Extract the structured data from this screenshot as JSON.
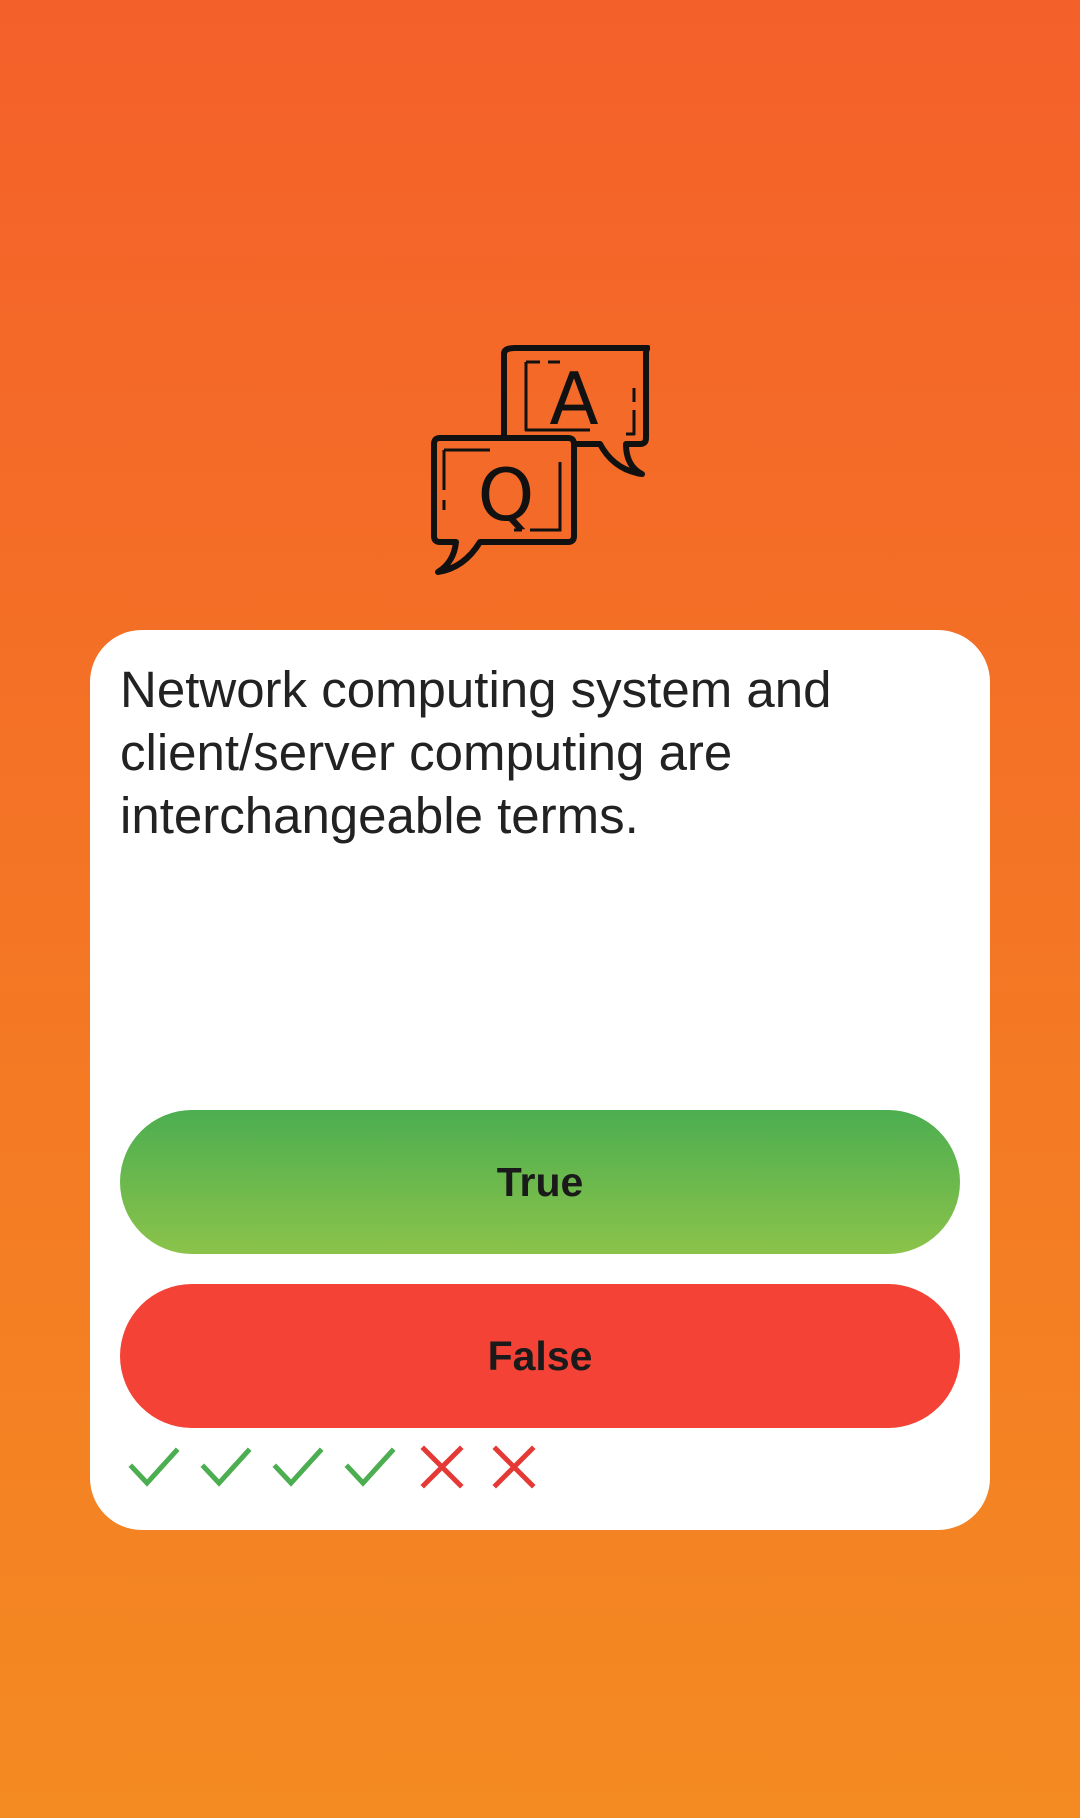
{
  "logo": {
    "icon": "qa-speech-bubbles-icon",
    "answer_letter": "A",
    "question_letter": "Q"
  },
  "quiz": {
    "question": "Network computing system and client/server computing are interchangeable terms.",
    "true_label": "True",
    "false_label": "False"
  },
  "history": [
    {
      "result": "correct",
      "icon": "check-icon"
    },
    {
      "result": "correct",
      "icon": "check-icon"
    },
    {
      "result": "correct",
      "icon": "check-icon"
    },
    {
      "result": "correct",
      "icon": "check-icon"
    },
    {
      "result": "wrong",
      "icon": "cross-icon"
    },
    {
      "result": "wrong",
      "icon": "cross-icon"
    }
  ],
  "colors": {
    "background_top": "#F4602A",
    "background_bottom": "#F48A22",
    "true_button_top": "#4CAE50",
    "true_button_bottom": "#8BC34A",
    "false_button": "#F44336",
    "correct_mark": "#4CAE50",
    "wrong_mark": "#E53935"
  }
}
